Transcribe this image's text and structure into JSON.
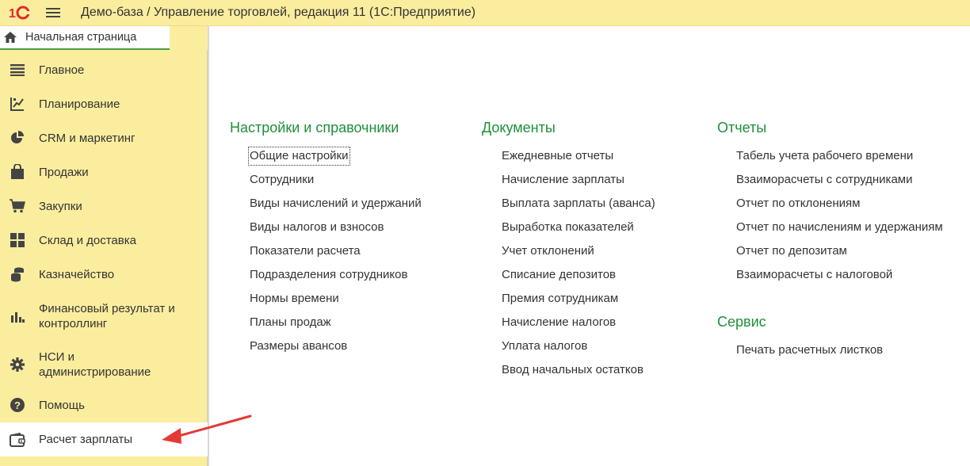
{
  "header": {
    "title": "Демо-база / Управление торговлей, редакция 11  (1С:Предприятие)"
  },
  "tabs": {
    "home": "Начальная страница"
  },
  "sidebar": {
    "items": [
      {
        "label": "Главное",
        "icon": "list-icon"
      },
      {
        "label": "Планирование",
        "icon": "planning-icon"
      },
      {
        "label": "CRM и маркетинг",
        "icon": "pie-chart-icon"
      },
      {
        "label": "Продажи",
        "icon": "shopping-bag-icon"
      },
      {
        "label": "Закупки",
        "icon": "cart-icon"
      },
      {
        "label": "Склад и доставка",
        "icon": "grid-icon"
      },
      {
        "label": "Казначейство",
        "icon": "coins-icon"
      },
      {
        "label": "Финансовый результат и\nконтроллинг",
        "icon": "bar-chart-icon"
      },
      {
        "label": "НСИ и\nадминистрирование",
        "icon": "gear-icon"
      },
      {
        "label": "Помощь",
        "icon": "help-icon"
      },
      {
        "label": "Расчет зарплаты",
        "icon": "wallet-icon"
      }
    ]
  },
  "content": {
    "settings": {
      "title": "Настройки и справочники",
      "links": [
        "Общие настройки",
        "Сотрудники",
        "Виды начислений и удержаний",
        "Виды налогов и взносов",
        "Показатели расчета",
        "Подразделения сотрудников",
        "Нормы времени",
        "Планы продаж",
        "Размеры авансов"
      ]
    },
    "documents": {
      "title": "Документы",
      "links": [
        "Ежедневные отчеты",
        "Начисление зарплаты",
        "Выплата зарплаты (аванса)",
        "Выработка показателей",
        "Учет отклонений",
        "Списание депозитов",
        "Премия сотрудникам",
        "Начисление налогов",
        "Уплата налогов",
        "Ввод начальных остатков"
      ]
    },
    "reports": {
      "title": "Отчеты",
      "links": [
        "Табель учета рабочего времени",
        "Взаиморасчеты с сотрудниками",
        "Отчет по отклонениям",
        "Отчет по начислениям и удержаниям",
        "Отчет по депозитам",
        "Взаиморасчеты с налоговой"
      ]
    },
    "service": {
      "title": "Сервис",
      "links": [
        "Печать расчетных листков"
      ]
    }
  },
  "colors": {
    "panel": "#fbed9e",
    "section_title": "#1f8f3a",
    "arrow": "#e53935",
    "logo": "#e8272a"
  }
}
